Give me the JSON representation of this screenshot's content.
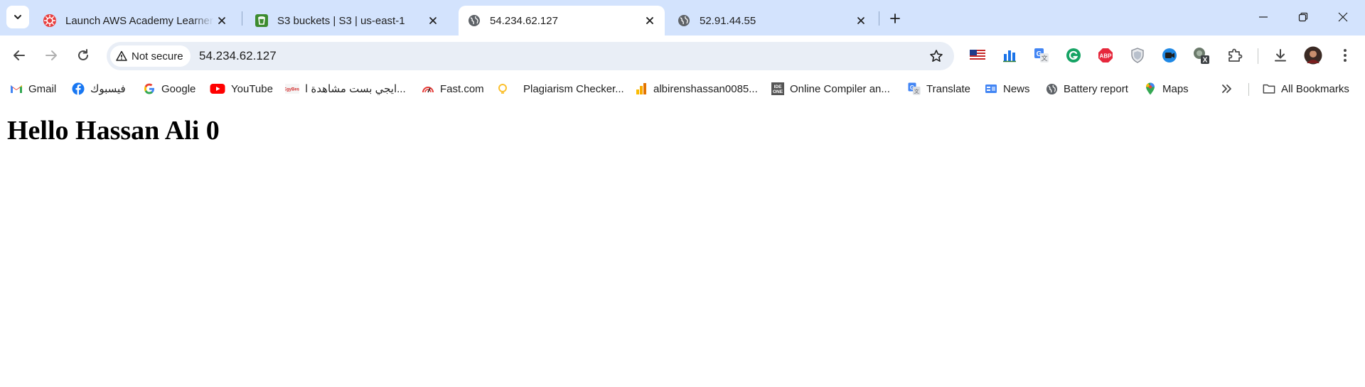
{
  "colors": {
    "tabstrip_bg": "#d3e3fd",
    "omnibox_bg": "#e9eef6",
    "icon": "#474747"
  },
  "tabs": [
    {
      "title": "Launch AWS Academy Learner Lab",
      "favicon": "aws-academy-icon",
      "active": false
    },
    {
      "title": "S3 buckets | S3 | us-east-1",
      "favicon": "s3-icon",
      "active": false
    },
    {
      "title": "54.234.62.127",
      "favicon": "globe-icon",
      "active": true
    },
    {
      "title": "52.91.44.55",
      "favicon": "globe-icon",
      "active": false
    }
  ],
  "omnibox": {
    "security_label": "Not secure",
    "url": "54.234.62.127"
  },
  "extensions": [
    "us-flag-icon",
    "bar-chart-icon",
    "google-translate-icon",
    "grammarly-icon",
    "adblock-plus-icon",
    "shield-icon",
    "video-icon",
    "extension-x-icon"
  ],
  "bookmarks": [
    {
      "label": "Gmail",
      "icon": "gmail-icon"
    },
    {
      "label": "فيسبوك",
      "icon": "facebook-icon"
    },
    {
      "label": "Google",
      "icon": "google-icon"
    },
    {
      "label": "YouTube",
      "icon": "youtube-icon"
    },
    {
      "label": "ايجي بست مشاهدة ا...",
      "icon": "egybest-icon"
    },
    {
      "label": "Fast.com",
      "icon": "speed-icon"
    },
    {
      "label": "Plagiarism Checker...",
      "icon": "bulb-icon"
    },
    {
      "label": "albirenshassan0085...",
      "icon": "analytics-icon"
    },
    {
      "label": "Online Compiler an...",
      "icon": "ideone-icon"
    },
    {
      "label": "Translate",
      "icon": "translate-icon"
    },
    {
      "label": "News",
      "icon": "news-icon"
    },
    {
      "label": "Battery report",
      "icon": "globe-icon"
    },
    {
      "label": "Maps",
      "icon": "maps-icon"
    }
  ],
  "all_bookmarks_label": "All Bookmarks",
  "page": {
    "heading": "Hello Hassan Ali 0"
  }
}
